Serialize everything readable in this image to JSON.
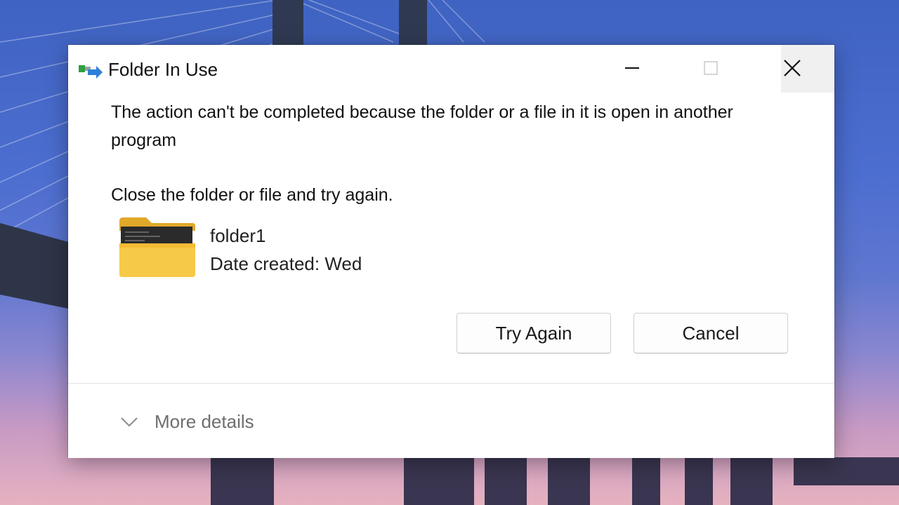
{
  "dialog": {
    "title": "Folder In Use",
    "message": "The action can't be completed because the folder or a file in it is open in another program",
    "instruction": "Close the folder or file and try again.",
    "item": {
      "name": "folder1",
      "date_created": "Date created: Wed"
    },
    "buttons": {
      "try_again": "Try Again",
      "cancel": "Cancel"
    },
    "more_details": "More details"
  },
  "icons": {
    "app": "folder-move-icon",
    "folder": "folder-icon",
    "minimize": "minimize-icon",
    "maximize": "maximize-icon",
    "close": "close-icon",
    "more": "chevron-down-icon"
  },
  "colors": {
    "folder_yellow": "#f7c948",
    "accent_blue": "#2f7fd8",
    "accent_green": "#2ea043"
  }
}
